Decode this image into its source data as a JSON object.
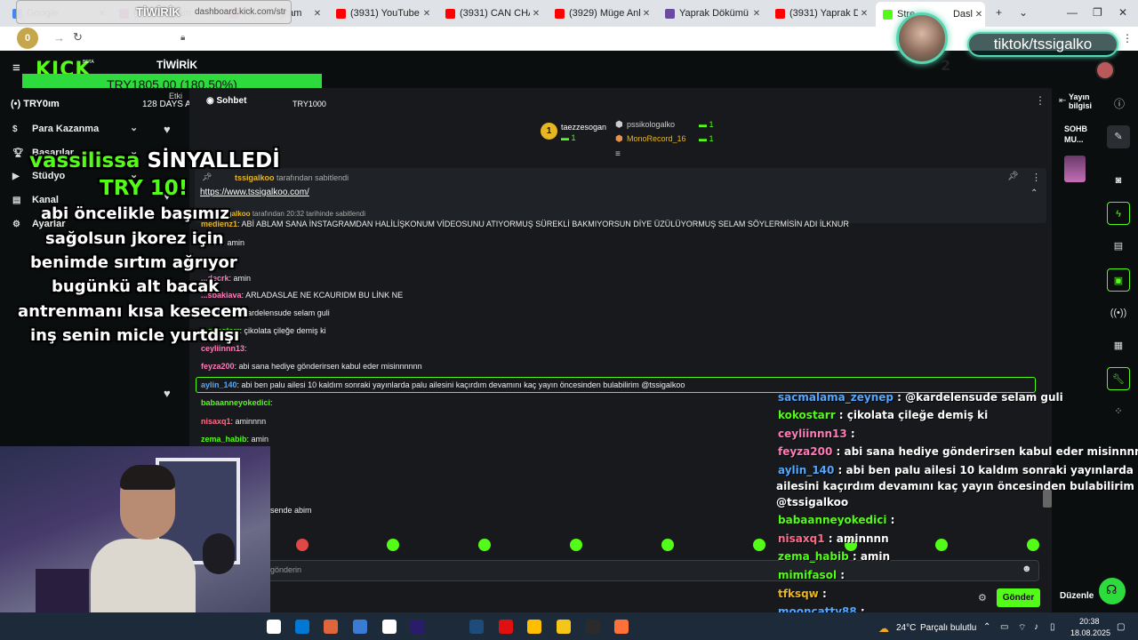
{
  "browser": {
    "tabs": [
      {
        "title": "Google",
        "color": "#4285f4"
      },
      {
        "title": "(1) Instagram",
        "color": "#d6249f"
      },
      {
        "title": "(1) Instagram",
        "color": "#d6249f"
      },
      {
        "title": "(3931) YouTube",
        "color": "#ff0000"
      },
      {
        "title": "(3931) CAN CHAPLIN E",
        "color": "#ff0000"
      },
      {
        "title": "(3929) Müge Anlı ile Tat",
        "color": "#ff0000"
      },
      {
        "title": "Yaprak Dökümü 78. Böl",
        "color": "#6b4aa0"
      },
      {
        "title": "(3931) Yaprak Dökümü",
        "color": "#ff0000"
      },
      {
        "title": "Stre",
        "color": "#53fc18"
      }
    ],
    "active_tab_suffix": "Dasl",
    "new_tab": "+",
    "address_url": "dashboard.kick.com/str",
    "address_overlay": "TİWİRİK",
    "badge_count": "0",
    "window_min": "—",
    "window_max": "❐",
    "window_close": "✕"
  },
  "header": {
    "logo": "KICK",
    "beta": "BETA",
    "tiwirik": "TİWİRİK",
    "goal_bar": "TRY1805.00 (180.50%)"
  },
  "sidebar": {
    "try_label": "TRY0",
    "try_partial": "ım",
    "days_label": "128 DAYS AGO",
    "etki_label": "Etki",
    "items": [
      {
        "label": "Para Kazanma",
        "icon": "dollar-icon"
      },
      {
        "label": "Başarılar",
        "icon": "trophy-icon"
      },
      {
        "label": "Stüdyo",
        "icon": "studio-icon"
      },
      {
        "label": "Kanal",
        "icon": "channel-icon"
      },
      {
        "label": "Ayarlar",
        "icon": "gear-icon"
      }
    ]
  },
  "chat": {
    "tab_label": "Sohbet",
    "try1000": "TRY1000",
    "leaderboard": [
      {
        "name": "taezzesogan",
        "count": "1"
      },
      {
        "name": "pssikologalko",
        "count": "1"
      },
      {
        "name": "MonoRecord_16",
        "count": "1"
      }
    ],
    "rank1": "1",
    "pinned_by_user": "tssigalkoo",
    "pinned_by_text": "tarafından sabitlendi",
    "pinned_url": "https://www.tssigalkoo.com/",
    "pinned_time_user": "tssigalkoo",
    "pinned_time_text": "tarafından 20:32 tarihinde sabitlendi",
    "messages": [
      {
        "user": "medienz1",
        "text": "ABİ ABLAM SANA İNSTAGRAMDAN HALİLİŞKONUM VİDEOSUNU ATIYORMUŞ SÜREKLİ BAKMIYORSUN DİYE ÜZÜLÜYORMUŞ SELAM SÖYLERMİSİN ADI İLKNUR",
        "color": "#e7b623"
      },
      {
        "user": "...rrce",
        "text": "amin",
        "color": "#ff7ab8"
      },
      {
        "user": "",
        "text": "",
        "color": "#ffffff"
      },
      {
        "user": "...decrk",
        "text": "amin",
        "color": "#ff7ab8"
      },
      {
        "user": "...sbakiava",
        "text": "ARLADASLAE NE KCAURIDM BU LİNK NE",
        "color": "#ff7ab8"
      },
      {
        "user": "...eynep",
        "text": "@kardelensude selam guli",
        "color": "#53a7ff"
      },
      {
        "user": "...okostarr",
        "text": "çikolata çileğe demiş ki",
        "color": "#53fc18"
      },
      {
        "user": "ceyliinnn13",
        "text": "",
        "color": "#ff7ab8"
      },
      {
        "user": "feyza200",
        "text": "abi sana hediye gönderirsen kabul eder misinnnnnn",
        "color": "#ff7ab8"
      },
      {
        "user": "aylin_140",
        "text": "abi ben palu ailesi 10 kaldım sonraki yayınlarda palu ailesini kaçırdım devamını kaç yayın öncesinden bulabilirim @tssigalkoo",
        "color": "#53a7ff"
      },
      {
        "user": "babaanneyokedici",
        "text": "",
        "color": "#53fc18"
      },
      {
        "user": "nisaxq1",
        "text": "aminnnn",
        "color": "#ff6b8a"
      },
      {
        "user": "zema_habib",
        "text": "amin",
        "color": "#53fc18"
      },
      {
        "user": "",
        "text": "sende abim",
        "color": "#ffffff"
      }
    ],
    "input_placeholder": "gönderin",
    "send_label": "Gönder"
  },
  "right": {
    "yayin_line1": "Yayın",
    "yayin_line2": "bilgisi",
    "sohb_line1": "SOHB",
    "sohb_line2": "MU...",
    "duzenle": "Düzenle"
  },
  "overlay": {
    "donor": "vassilissa",
    "signal": "SİNYALLEDİ",
    "amount": "TRY 10!",
    "message_lines": [
      "abi öncelikle başımız",
      "sağolsun jkorez için",
      "benimde sırtım ağrıyor",
      "bugünkü alt bacak",
      "antrenmanı kısa kesecem",
      "inş senin micle yurtdışı"
    ],
    "tiktok": "tiktok/tssigalko",
    "corner_num": "2"
  },
  "overlay_chat": [
    {
      "user": "sacmalama_zeynep",
      "text": "@kardelensude selam guli",
      "color": "#53a7ff"
    },
    {
      "user": "kokostarr",
      "text": "çikolata çileğe demiş ki",
      "color": "#53fc18"
    },
    {
      "user": "ceyliinnn13",
      "text": "",
      "color": "#ff7ab8"
    },
    {
      "user": "feyza200",
      "text": "abi sana hediye gönderirsen kabul eder misinnnnnn",
      "color": "#ff7ab8"
    },
    {
      "user": "aylin_140",
      "text": "abi ben palu ailesi 10 kaldım sonraki yayınlarda palu",
      "color": "#53a7ff"
    },
    {
      "user": "",
      "text": "ailesini kaçırdım devamını kaç yayın öncesinden bulabilirim",
      "color": "#ffffff"
    },
    {
      "user": "",
      "text": "@tssigalkoo",
      "color": "#ffffff"
    },
    {
      "user": "babaanneyokedici",
      "text": "",
      "color": "#53fc18"
    },
    {
      "user": "nisaxq1",
      "text": "aminnnn",
      "color": "#ff6b8a"
    },
    {
      "user": "zema_habib",
      "text": "amin",
      "color": "#53fc18"
    },
    {
      "user": "mimifasol",
      "text": "",
      "color": "#53fc18"
    },
    {
      "user": "tfksqw",
      "text": "",
      "color": "#e7b623"
    },
    {
      "user": "mooncatty88",
      "text": "",
      "color": "#53a7ff"
    }
  ],
  "taskbar": {
    "weather_temp": "24°C",
    "weather_text": "Parçalı bulutlu",
    "time": "20:38",
    "date": "18.08.2025"
  },
  "colors": {
    "accent": "#53fc18",
    "gold": "#e7b623",
    "bg": "#0b0e0f",
    "panel": "#17191c"
  }
}
